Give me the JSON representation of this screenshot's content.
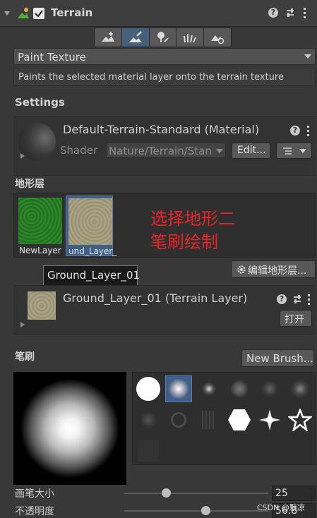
{
  "header": {
    "title": "Terrain"
  },
  "toolbar": {
    "icons": [
      "create-neighbor-icon",
      "paint-terrain-icon",
      "paint-trees-icon",
      "paint-details-icon",
      "terrain-settings-icon"
    ],
    "active_index": 1
  },
  "tool_dropdown": {
    "value": "Paint Texture"
  },
  "description": "Paints the selected material layer onto the terrain texture",
  "settings": {
    "title": "Settings",
    "material_name": "Default-Terrain-Standard (Material)",
    "shader_label": "Shader",
    "shader_value": "Nature/Terrain/Stan",
    "edit_button": "Edit..."
  },
  "layers": {
    "title": "地形层",
    "items": [
      {
        "label": "NewLayer",
        "color": "#2b7a28"
      },
      {
        "label": "und_Layer_",
        "color": "#a8a080",
        "selected": true
      }
    ],
    "annotation_line1": "选择地形二",
    "annotation_line2": "笔刷绘制",
    "annotation_color": "#e8232a",
    "tooltip": "Ground_Layer_01",
    "edit_layers_button": "编辑地形层..."
  },
  "terrain_layer": {
    "name": "Ground_Layer_01 (Terrain Layer)",
    "open_button": "打开"
  },
  "brushes": {
    "title": "笔刷",
    "new_brush_button": "New Brush..."
  },
  "brush_size": {
    "label": "画笔大小",
    "value": "25",
    "fraction": 0.28
  },
  "opacity": {
    "label": "不透明度",
    "value": "56.8",
    "fraction": 0.57
  },
  "watermark": "CSDN @默凉"
}
